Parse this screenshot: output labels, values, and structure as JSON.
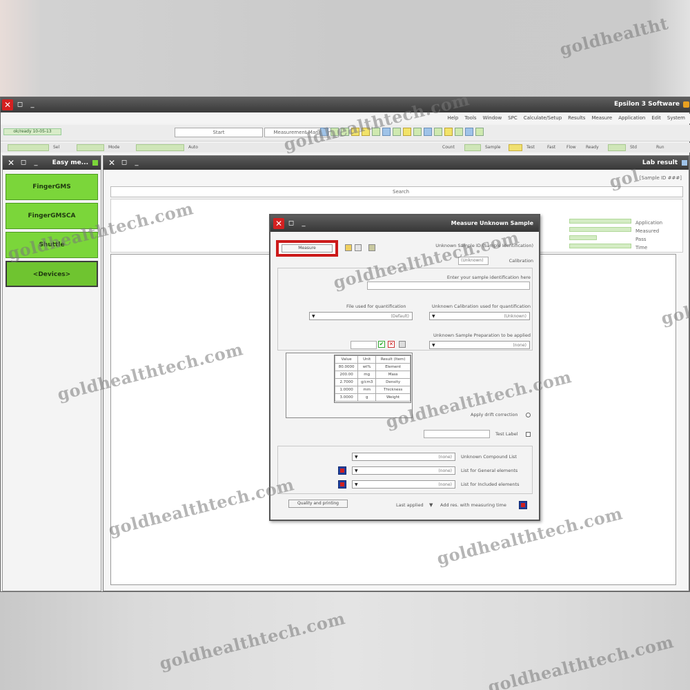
{
  "app": {
    "title": "Epsilon 3 Software",
    "menu": [
      "Help",
      "Tools",
      "Window",
      "SPC",
      "Calculate/Setup",
      "Results",
      "Measure",
      "Application",
      "Edit",
      "System"
    ],
    "toolbar": {
      "center_label": "Start",
      "right_label": "Measurement Manager",
      "status_label": "ok/ready 10-05-13"
    }
  },
  "info_bar": {
    "labels": [
      "Sel",
      "Mode",
      "Auto",
      "Count",
      "Sample",
      "Test",
      "Fast",
      "Flow",
      "Ready",
      "Std",
      "Run"
    ]
  },
  "left_pane": {
    "title": "Easy me...",
    "buttons": [
      "FingerGMS",
      "FingerGMSCA",
      "Shuttle",
      "<Devices>"
    ]
  },
  "right_pane": {
    "title": "Lab result",
    "subtitle": "[Sample ID ###]",
    "search_label": "Search",
    "field_labels": [
      "Application",
      "Measured",
      "Pass",
      "Time"
    ]
  },
  "dialog": {
    "title": "Measure Unknown Sample",
    "start_button": "Measure",
    "sample_id_label": "Unknown Sample ID (Sample Identification)",
    "calibration_label": "Calibration",
    "sample_desc_label": "Enter your sample identification here",
    "sample_desc_value": "",
    "unknown_calib_label": "Unknown Calibration used for quantification",
    "unknown_calib_value": "(Unknown)",
    "file_label": "File used for quantification",
    "file_value": "(Default)",
    "sample_prep_label": "Unknown Sample Preparation to be applied",
    "sample_prep_value": "(none)",
    "amount_value": "",
    "table": [
      [
        "Result (Item)",
        "Unit",
        "Value"
      ],
      [
        "Element",
        "wt%",
        "80.0000"
      ],
      [
        "Mass",
        "mg",
        "200.00"
      ],
      [
        "Density",
        "g/cm3",
        "2.7000"
      ],
      [
        "Thickness",
        "mm",
        "1.0000"
      ],
      [
        "Weight",
        "g",
        "3.0000"
      ]
    ],
    "drift_label": "Apply drift correction",
    "test_label": "Test Label",
    "test_value": "",
    "prep_compound_label": "Unknown Compound List",
    "prep_compound_value": "(none)",
    "list_general_label": "List for General elements",
    "list_general_value": "(none)",
    "list_include_label": "List for Included elements",
    "list_include_value": "(none)",
    "save_label": "Add res. with measuring time",
    "view_label": "Last applied",
    "print_button": "Quality and printing"
  },
  "watermark": "goldhealthtech.com",
  "watermark_top": "goldhealtht",
  "watermark_side": "gol"
}
